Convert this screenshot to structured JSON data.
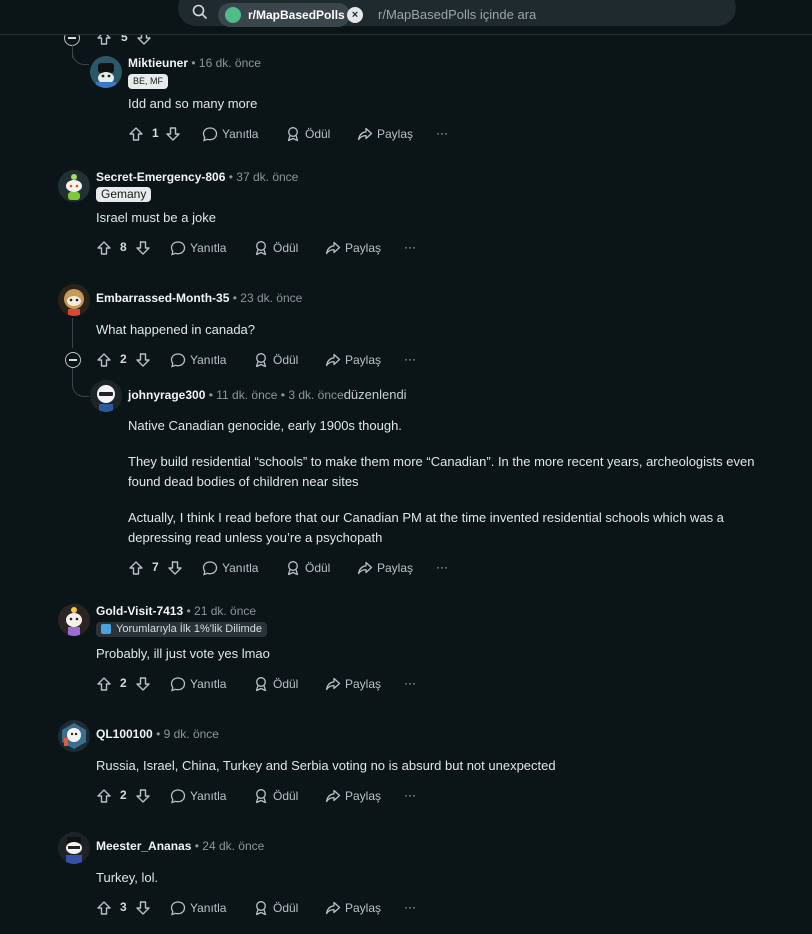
{
  "search": {
    "subreddit_chip": "r/MapBasedPolls",
    "placeholder": "r/MapBasedPolls içinde ara"
  },
  "actions": {
    "reply": "Yanıtla",
    "award": "Ödül",
    "share": "Paylaş",
    "more": "···"
  },
  "partial_row": {
    "votes": "5"
  },
  "comments": [
    {
      "username": "Miktieuner",
      "time": "16 dk. önce",
      "flair": "BE, MF",
      "body": [
        "Idd and so many more"
      ],
      "votes": "1"
    },
    {
      "username": "Secret-Emergency-806",
      "time": "37 dk. önce",
      "flair": "Gemany",
      "body": [
        "Israel must be a joke"
      ],
      "votes": "8"
    },
    {
      "username": "Embarrassed-Month-35",
      "time": "23 dk. önce",
      "body": [
        "What happened in canada?"
      ],
      "votes": "2"
    },
    {
      "username": "johnyrage300",
      "time": "11 dk. önce",
      "edit_time": "3 dk. önce",
      "edited": "düzenlendi",
      "body": [
        "Native Canadian genocide, early 1900s though.",
        "They build residential “schools” to make them more “Canadian”. In the more recent years, archeologists even found dead bodies of children near sites",
        "Actually, I think I read before that our Canadian PM at the time invented residential schools which was a depressing read unless you’re a psychopath"
      ],
      "votes": "7"
    },
    {
      "username": "Gold-Visit-7413",
      "time": "21 dk. önce",
      "flair": "Yorumlarıyla İlk 1%'lik Dilimde",
      "body": [
        "Probably, ill just vote yes lmao"
      ],
      "votes": "2"
    },
    {
      "username": "QL100100",
      "time": "9 dk. önce",
      "body": [
        "Russia, Israel, China, Turkey and Serbia voting no is absurd but not unexpected"
      ],
      "votes": "2"
    },
    {
      "username": "Meester_Ananas",
      "time": "24 dk. önce",
      "body": [
        "Turkey, lol."
      ],
      "votes": "3"
    }
  ],
  "colors": {
    "background": "#0b1416",
    "text": "#d7dadc",
    "meta": "#8b979b",
    "thread_line": "#3b4549"
  },
  "icons": [
    "search-icon",
    "upvote-icon",
    "downvote-icon",
    "reply-icon",
    "award-icon",
    "share-icon",
    "more-icon",
    "collapse-icon",
    "close-icon"
  ]
}
